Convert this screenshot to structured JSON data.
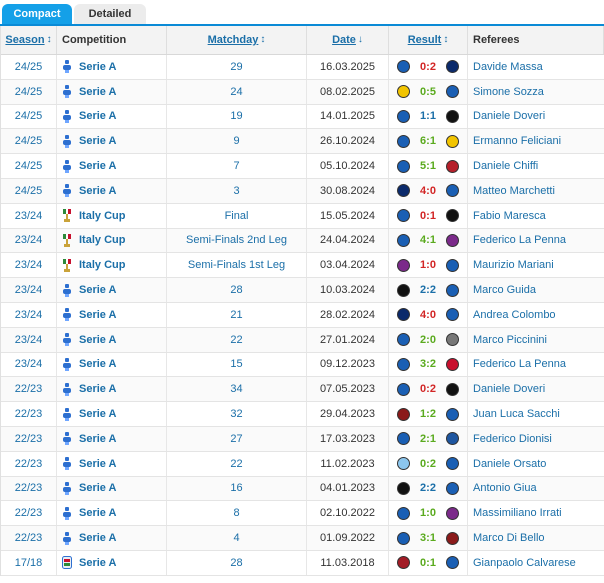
{
  "tabs": {
    "compact": "Compact",
    "detailed": "Detailed"
  },
  "header": {
    "season": "Season",
    "season_arrow": "↕",
    "competition": "Competition",
    "matchday": "Matchday",
    "matchday_arrow": "↕",
    "date": "Date",
    "date_arrow": "↓",
    "result": "Result",
    "result_arrow": "↕",
    "referees": "Referees"
  },
  "colors": {
    "link": "#1b6fa8",
    "win": "#5aaa1e",
    "loss": "#d22525",
    "draw": "#1b6fa8",
    "tab_active": "#14a0e8"
  },
  "crest_colors": {
    "atalanta": "#1a5fb4",
    "inter": "#0b2a6b",
    "verona": "#f2c400",
    "juventus": "#111111",
    "genoa": "#b51f2a",
    "fiorentina": "#7b2a8a",
    "milan": "#c8102e",
    "udinese": "#777777",
    "torino": "#8b1a1a",
    "empoli": "#1e56a0",
    "lazio": "#8cc6ee",
    "spezia": "#111111",
    "bologna": "#a21c26",
    "salernitana": "#7a1f2b"
  },
  "rows": [
    {
      "season": "24/25",
      "comp": "Serie A",
      "comp_icon": "serie-a-icon",
      "md": "29",
      "date": "16.03.2025",
      "home": "atalanta",
      "score": "0:2",
      "outcome": "loss",
      "away": "inter",
      "ref": "Davide Massa"
    },
    {
      "season": "24/25",
      "comp": "Serie A",
      "comp_icon": "serie-a-icon",
      "md": "24",
      "date": "08.02.2025",
      "home": "verona",
      "score": "0:5",
      "outcome": "win",
      "away": "atalanta",
      "ref": "Simone Sozza"
    },
    {
      "season": "24/25",
      "comp": "Serie A",
      "comp_icon": "serie-a-icon",
      "md": "19",
      "date": "14.01.2025",
      "home": "atalanta",
      "score": "1:1",
      "outcome": "draw",
      "away": "juventus",
      "ref": "Daniele Doveri"
    },
    {
      "season": "24/25",
      "comp": "Serie A",
      "comp_icon": "serie-a-icon",
      "md": "9",
      "date": "26.10.2024",
      "home": "atalanta",
      "score": "6:1",
      "outcome": "win",
      "away": "verona",
      "ref": "Ermanno Feliciani"
    },
    {
      "season": "24/25",
      "comp": "Serie A",
      "comp_icon": "serie-a-icon",
      "md": "7",
      "date": "05.10.2024",
      "home": "atalanta",
      "score": "5:1",
      "outcome": "win",
      "away": "genoa",
      "ref": "Daniele Chiffi"
    },
    {
      "season": "24/25",
      "comp": "Serie A",
      "comp_icon": "serie-a-icon",
      "md": "3",
      "date": "30.08.2024",
      "home": "inter",
      "score": "4:0",
      "outcome": "loss",
      "away": "atalanta",
      "ref": "Matteo Marchetti"
    },
    {
      "season": "23/24",
      "comp": "Italy Cup",
      "comp_icon": "italy-cup-icon",
      "md": "Final",
      "date": "15.05.2024",
      "home": "atalanta",
      "score": "0:1",
      "outcome": "loss",
      "away": "juventus",
      "ref": "Fabio Maresca"
    },
    {
      "season": "23/24",
      "comp": "Italy Cup",
      "comp_icon": "italy-cup-icon",
      "md": "Semi-Finals 2nd Leg",
      "date": "24.04.2024",
      "home": "atalanta",
      "score": "4:1",
      "outcome": "win",
      "away": "fiorentina",
      "ref": "Federico La Penna"
    },
    {
      "season": "23/24",
      "comp": "Italy Cup",
      "comp_icon": "italy-cup-icon",
      "md": "Semi-Finals 1st Leg",
      "date": "03.04.2024",
      "home": "fiorentina",
      "score": "1:0",
      "outcome": "loss",
      "away": "atalanta",
      "ref": "Maurizio Mariani"
    },
    {
      "season": "23/24",
      "comp": "Serie A",
      "comp_icon": "serie-a-icon",
      "md": "28",
      "date": "10.03.2024",
      "home": "juventus",
      "score": "2:2",
      "outcome": "draw",
      "away": "atalanta",
      "ref": "Marco Guida"
    },
    {
      "season": "23/24",
      "comp": "Serie A",
      "comp_icon": "serie-a-icon",
      "md": "21",
      "date": "28.02.2024",
      "home": "inter",
      "score": "4:0",
      "outcome": "loss",
      "away": "atalanta",
      "ref": "Andrea Colombo"
    },
    {
      "season": "23/24",
      "comp": "Serie A",
      "comp_icon": "serie-a-icon",
      "md": "22",
      "date": "27.01.2024",
      "home": "atalanta",
      "score": "2:0",
      "outcome": "win",
      "away": "udinese",
      "ref": "Marco Piccinini"
    },
    {
      "season": "23/24",
      "comp": "Serie A",
      "comp_icon": "serie-a-icon",
      "md": "15",
      "date": "09.12.2023",
      "home": "atalanta",
      "score": "3:2",
      "outcome": "win",
      "away": "milan",
      "ref": "Federico La Penna"
    },
    {
      "season": "22/23",
      "comp": "Serie A",
      "comp_icon": "serie-a-icon",
      "md": "34",
      "date": "07.05.2023",
      "home": "atalanta",
      "score": "0:2",
      "outcome": "loss",
      "away": "juventus",
      "ref": "Daniele Doveri"
    },
    {
      "season": "22/23",
      "comp": "Serie A",
      "comp_icon": "serie-a-icon",
      "md": "32",
      "date": "29.04.2023",
      "home": "torino",
      "score": "1:2",
      "outcome": "win",
      "away": "atalanta",
      "ref": "Juan Luca Sacchi"
    },
    {
      "season": "22/23",
      "comp": "Serie A",
      "comp_icon": "serie-a-icon",
      "md": "27",
      "date": "17.03.2023",
      "home": "atalanta",
      "score": "2:1",
      "outcome": "win",
      "away": "empoli",
      "ref": "Federico Dionisi"
    },
    {
      "season": "22/23",
      "comp": "Serie A",
      "comp_icon": "serie-a-icon",
      "md": "22",
      "date": "11.02.2023",
      "home": "lazio",
      "score": "0:2",
      "outcome": "win",
      "away": "atalanta",
      "ref": "Daniele Orsato"
    },
    {
      "season": "22/23",
      "comp": "Serie A",
      "comp_icon": "serie-a-icon",
      "md": "16",
      "date": "04.01.2023",
      "home": "spezia",
      "score": "2:2",
      "outcome": "draw",
      "away": "atalanta",
      "ref": "Antonio Giua"
    },
    {
      "season": "22/23",
      "comp": "Serie A",
      "comp_icon": "serie-a-icon",
      "md": "8",
      "date": "02.10.2022",
      "home": "atalanta",
      "score": "1:0",
      "outcome": "win",
      "away": "fiorentina",
      "ref": "Massimiliano Irrati"
    },
    {
      "season": "22/23",
      "comp": "Serie A",
      "comp_icon": "serie-a-icon",
      "md": "4",
      "date": "01.09.2022",
      "home": "atalanta",
      "score": "3:1",
      "outcome": "win",
      "away": "torino",
      "ref": "Marco Di Bello"
    },
    {
      "season": "17/18",
      "comp": "Serie A",
      "comp_icon": "serie-a-old-icon",
      "md": "28",
      "date": "11.03.2018",
      "home": "bologna",
      "score": "0:1",
      "outcome": "win",
      "away": "atalanta",
      "ref": "Gianpaolo Calvarese"
    }
  ]
}
